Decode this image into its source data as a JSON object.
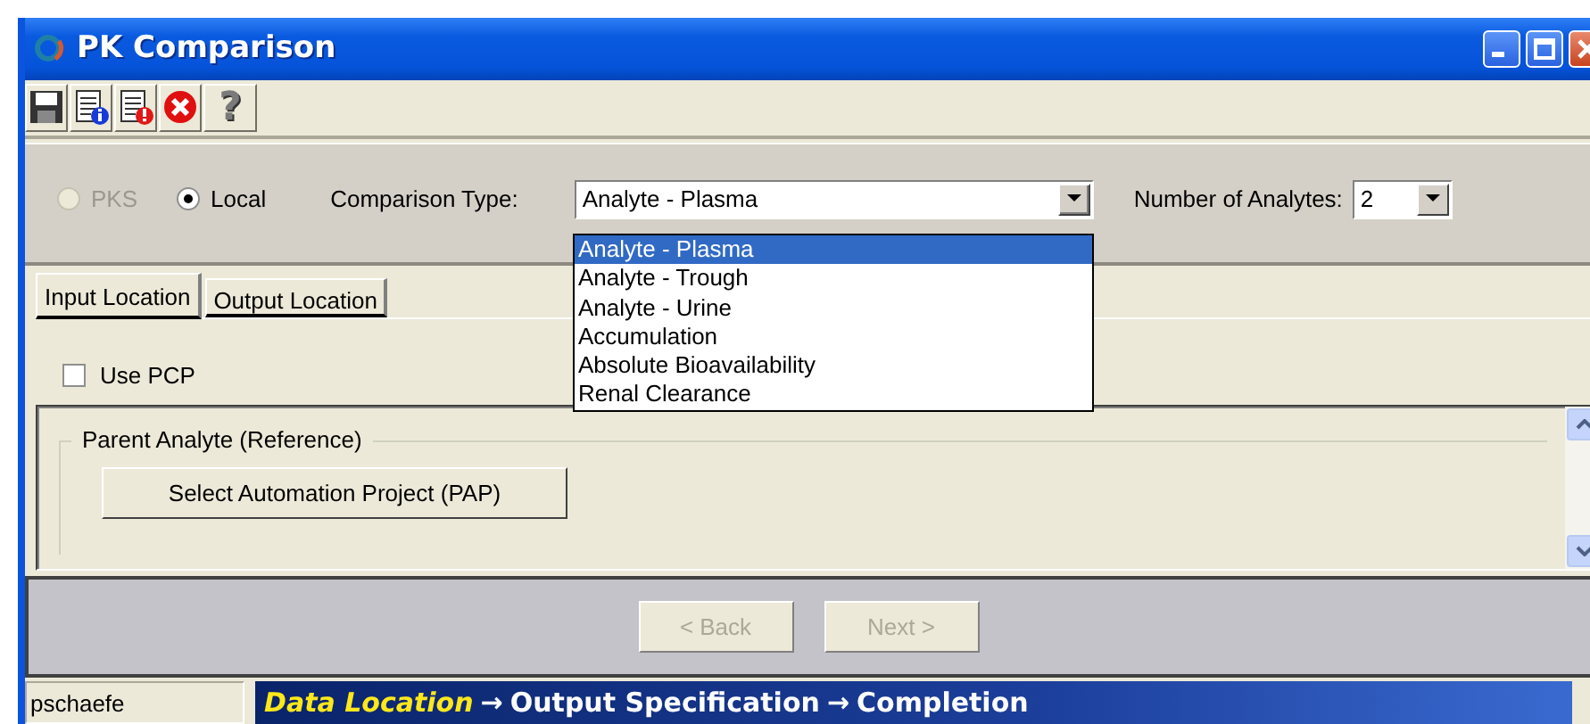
{
  "window": {
    "title": "PK Comparison"
  },
  "toolbar": [
    {
      "kind": "save"
    },
    {
      "kind": "info"
    },
    {
      "kind": "alert"
    },
    {
      "kind": "cancel"
    },
    {
      "kind": "help",
      "glyph": "?"
    }
  ],
  "source": [
    {
      "label": "PKS",
      "selected": false,
      "disabled": true
    },
    {
      "label": "Local",
      "selected": true,
      "disabled": false
    }
  ],
  "comparison_type": {
    "label": "Comparison Type:",
    "value": "Analyte - Plasma",
    "expanded": true,
    "options": [
      {
        "label": "Analyte - Plasma",
        "selected": true
      },
      {
        "label": "Analyte - Trough",
        "selected": false
      },
      {
        "label": "Analyte - Urine",
        "selected": false
      },
      {
        "label": "Accumulation",
        "selected": false
      },
      {
        "label": "Absolute Bioavailability",
        "selected": false
      },
      {
        "label": "Renal Clearance",
        "selected": false
      }
    ]
  },
  "analytes": {
    "label": "Number of Analytes:",
    "value": "2"
  },
  "tabs": [
    {
      "label": "Input Location",
      "selected": true
    },
    {
      "label": "Output Location",
      "selected": false
    }
  ],
  "use_pcp": {
    "label": "Use PCP",
    "checked": false
  },
  "parent_group": {
    "title": "Parent Analyte (Reference)",
    "button": "Select Automation Project (PAP)"
  },
  "nav_buttons": [
    {
      "label": "< Back",
      "disabled": true
    },
    {
      "label": "Next >",
      "disabled": true
    }
  ],
  "status_bar": {
    "user": "pschaefe",
    "steps": [
      {
        "label": "Data Location",
        "current": true,
        "arrow": "→"
      },
      {
        "label": "Output Specification",
        "current": false,
        "arrow": "→"
      },
      {
        "label": "Completion",
        "current": false
      }
    ]
  }
}
